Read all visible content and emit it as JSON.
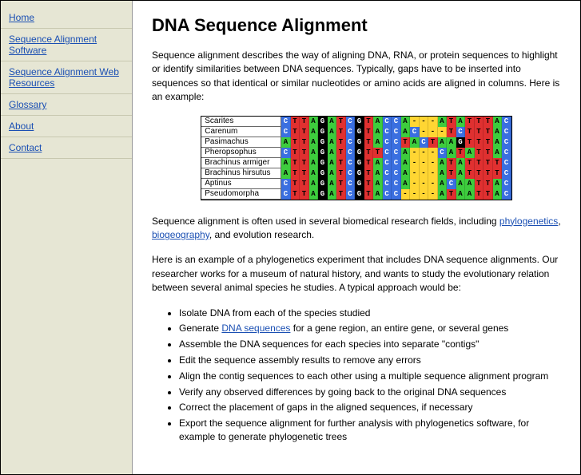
{
  "sidebar": {
    "items": [
      {
        "label": "Home"
      },
      {
        "label": "Sequence Alignment Software"
      },
      {
        "label": "Sequence Alignment Web Resources"
      },
      {
        "label": "Glossary"
      },
      {
        "label": "About"
      },
      {
        "label": "Contact"
      }
    ]
  },
  "main": {
    "title": "DNA Sequence Alignment",
    "intro": "Sequence alignment describes the way of aligning DNA, RNA, or protein sequences to highlight or identify similarities between DNA sequences. Typically, gaps have to be inserted into sequences so that identical or similar nucleotides or amino acids are aligned in columns. Here is an example:",
    "alignment": {
      "species": [
        "Scarites",
        "Carenum",
        "Pasimachus",
        "Pheropsophus",
        "Brachinus armiger",
        "Brachinus hirsutus",
        "Aptinus",
        "Pseudomorpha"
      ],
      "sequences": [
        "CTTAGATCGTACCA---ATATTTAC",
        "CTTAGATCGTACCAC---TCTTTAC",
        "ATTAGATCGTACCTACTAAGTTTAC",
        "CTTAGATCGTTCCA---CATATTAC",
        "ATTAGATCGTACCA---ATATTTTC",
        "ATTAGATCGTACCA---ATATTTTC",
        "CTTAGATCGTACCA---ACAATTAC",
        "CTTAGATCGTACC----ATAATTAC"
      ]
    },
    "para2a": "Sequence alignment is often used in several biomedical research fields, including ",
    "link_phylo": "phylogenetics",
    "para2b": ", ",
    "link_biogeo": "biogeography",
    "para2c": ", and evolution research.",
    "para3": "Here is an example of a phylogenetics experiment that includes DNA sequence alignments. Our researcher works for a museum of natural history, and wants to study the evolutionary relation between several animal species he studies. A typical approach would be:",
    "steps": [
      {
        "pre": "Isolate DNA from each of the species studied"
      },
      {
        "pre": "Generate ",
        "link": "DNA sequences",
        "post": " for a gene region, an entire gene, or several genes"
      },
      {
        "pre": "Assemble the DNA sequences for each species into separate \"contigs\""
      },
      {
        "pre": "Edit the sequence assembly results to remove any errors"
      },
      {
        "pre": "Align the contig sequences to each other using a multiple sequence alignment program"
      },
      {
        "pre": "Verify any observed differences by going back to the original DNA sequences"
      },
      {
        "pre": "Correct the placement of gaps in the aligned sequences, if necessary"
      },
      {
        "pre": "Export the sequence alignment for further analysis with phylogenetics software, for example to generate phylogenetic trees"
      }
    ]
  }
}
